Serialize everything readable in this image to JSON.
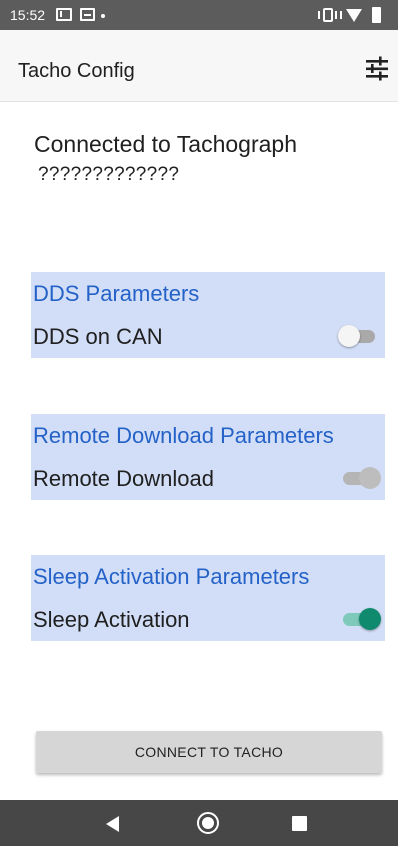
{
  "status_bar": {
    "time": "15:52",
    "icons": [
      "mail-icon",
      "calendar-icon",
      "notification-dot-icon",
      "vibrate-icon",
      "wifi-icon",
      "battery-icon"
    ]
  },
  "app_bar": {
    "title": "Tacho Config",
    "settings_icon": "tune-icon"
  },
  "connection": {
    "label": "Connected to Tachograph",
    "serial": "?????????????"
  },
  "sections": [
    {
      "title": "DDS Parameters",
      "label": "DDS on CAN",
      "switch_state": "off"
    },
    {
      "title": "Remote Download Parameters",
      "label": "Remote Download",
      "switch_state": "disabled"
    },
    {
      "title": "Sleep Activation Parameters",
      "label": "Sleep Activation",
      "switch_state": "on"
    }
  ],
  "connect_button": {
    "label": "CONNECT TO TACHO"
  },
  "nav_bar": {
    "icons": [
      "back-icon",
      "home-icon",
      "recents-icon"
    ]
  },
  "colors": {
    "section_background": "#d2def7",
    "section_title": "#2462c8",
    "switch_on_thumb": "#0f8a6e",
    "switch_on_track": "#7ec9b9",
    "status_bar": "#5c5c5c",
    "nav_bar": "#474747"
  }
}
